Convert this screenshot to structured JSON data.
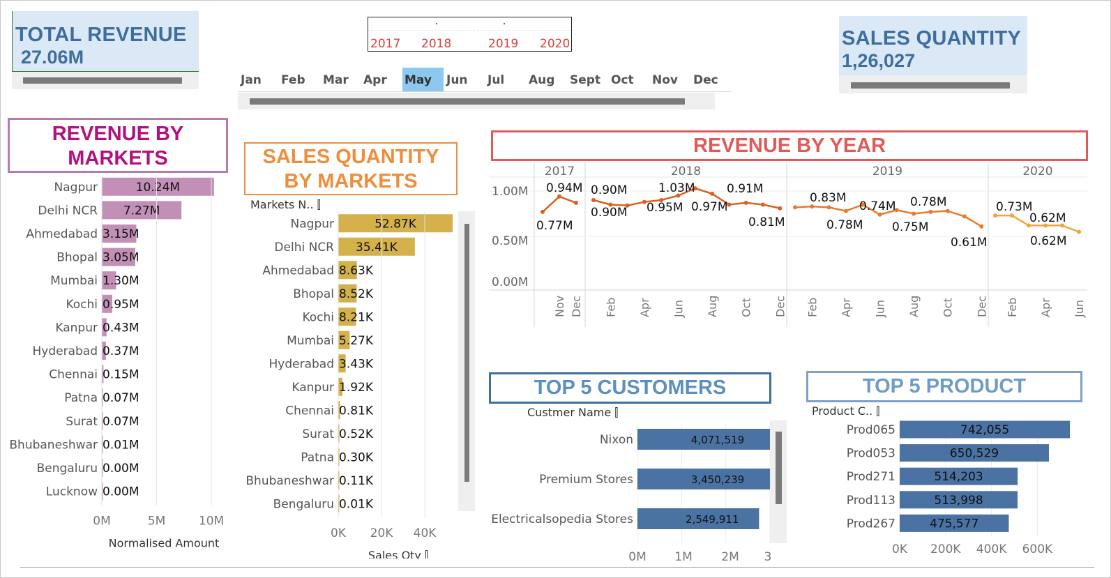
{
  "kpis": {
    "total_revenue": {
      "title": "TOTAL REVENUE",
      "value": "27.06M"
    },
    "sales_quantity": {
      "title": "SALES QUANTITY",
      "value": "1,26,027"
    }
  },
  "filters": {
    "years": [
      "2017",
      "2018",
      "2019",
      "2020"
    ],
    "months": [
      "Jan",
      "Feb",
      "Mar",
      "Apr",
      "May",
      "Jun",
      "Jul",
      "Aug",
      "Sept",
      "Oct",
      "Nov",
      "Dec"
    ],
    "selected_month": "May"
  },
  "titles": {
    "revenue_by_markets": "REVENUE BY MARKETS",
    "sales_qty_by_markets": "SALES QUANTITY BY MARKETS",
    "revenue_by_year": "REVENUE BY YEAR",
    "top5_customers": "TOP 5 CUSTOMERS",
    "top5_product": "TOP 5 PRODUCT"
  },
  "colors": {
    "revenue_bar": "#c28fb6",
    "qty_bar": "#d4b14a",
    "line": "#d9601f",
    "line_2020": "#f2a33a",
    "blue_bar": "#4a72a3",
    "kpi_bg": "#dbe8f5",
    "kpi_text": "#3e6e9e"
  },
  "chart_data": [
    {
      "type": "bar",
      "orientation": "horizontal",
      "categories": [
        "Nagpur",
        "Delhi NCR",
        "Ahmedabad",
        "Bhopal",
        "Mumbai",
        "Kochi",
        "Kanpur",
        "Hyderabad",
        "Chennai",
        "Patna",
        "Surat",
        "Bhubaneshwar",
        "Bengaluru",
        "Lucknow"
      ],
      "values": [
        10.24,
        7.27,
        3.15,
        3.05,
        1.3,
        0.95,
        0.43,
        0.37,
        0.15,
        0.07,
        0.07,
        0.01,
        0.0,
        0.0
      ],
      "labels": [
        "10.24M",
        "7.27M",
        "3.15M",
        "3.05M",
        "1.30M",
        "0.95M",
        "0.43M",
        "0.37M",
        "0.15M",
        "0.07M",
        "0.07M",
        "0.01M",
        "0.00M",
        "0.00M"
      ],
      "xticks": [
        "0M",
        "5M",
        "10M"
      ],
      "xlabel": "Normalised Amount",
      "xlim": [
        0,
        11
      ]
    },
    {
      "type": "bar",
      "orientation": "horizontal",
      "header": "Markets N..",
      "categories": [
        "Nagpur",
        "Delhi NCR",
        "Ahmedabad",
        "Bhopal",
        "Kochi",
        "Mumbai",
        "Hyderabad",
        "Kanpur",
        "Chennai",
        "Surat",
        "Patna",
        "Bhubaneshwar",
        "Bengaluru"
      ],
      "values": [
        52.87,
        35.41,
        8.63,
        8.52,
        8.21,
        5.27,
        3.43,
        1.92,
        0.81,
        0.52,
        0.3,
        0.11,
        0.01
      ],
      "labels": [
        "52.87K",
        "35.41K",
        "8.63K",
        "8.52K",
        "8.21K",
        "5.27K",
        "3.43K",
        "1.92K",
        "0.81K",
        "0.52K",
        "0.30K",
        "0.11K",
        "0.01K"
      ],
      "xticks": [
        "0K",
        "20K",
        "40K"
      ],
      "xlabel": "Sales Qty",
      "xlim": [
        0,
        53
      ]
    },
    {
      "type": "line",
      "years": [
        "2017",
        "2018",
        "2019",
        "2020"
      ],
      "yticks": [
        "1.00M",
        "0.50M",
        "0.00M"
      ],
      "ylim": [
        0,
        1.1
      ],
      "xtick_labels": {
        "2017": [
          "Nov",
          "Dec"
        ],
        "2018": [
          "Feb",
          "Apr",
          "Jun",
          "Aug",
          "Oct",
          "Dec"
        ],
        "2019": [
          "Feb",
          "Apr",
          "Jun",
          "Aug",
          "Oct",
          "Dec"
        ],
        "2020": [
          "Feb",
          "Apr",
          "Jun"
        ]
      },
      "series": [
        {
          "year": "2017",
          "months": [
            10,
            11,
            12
          ],
          "values": [
            0.77,
            0.94,
            0.87
          ]
        },
        {
          "year": "2018",
          "months": [
            1,
            2,
            3,
            4,
            5,
            6,
            7,
            8,
            9,
            10,
            11,
            12
          ],
          "values": [
            0.9,
            0.85,
            0.84,
            0.88,
            0.9,
            0.95,
            1.03,
            0.97,
            0.85,
            0.87,
            0.85,
            0.81
          ]
        },
        {
          "year": "2019",
          "months": [
            1,
            2,
            3,
            4,
            5,
            6,
            7,
            8,
            9,
            10,
            11,
            12
          ],
          "values": [
            0.82,
            0.83,
            0.82,
            0.78,
            0.85,
            0.74,
            0.79,
            0.75,
            0.77,
            0.78,
            0.72,
            0.61
          ]
        },
        {
          "year": "2020",
          "months": [
            1,
            2,
            3,
            4,
            5,
            6
          ],
          "values": [
            0.73,
            0.73,
            0.62,
            0.62,
            0.62,
            0.55
          ]
        }
      ],
      "annotations": [
        "0.77M",
        "0.94M",
        "0.90M",
        "0.90M",
        "0.95M",
        "1.03M",
        "0.97M",
        "0.91M",
        "0.81M",
        "0.83M",
        "0.78M",
        "0.74M",
        "0.75M",
        "0.78M",
        "0.61M",
        "0.73M",
        "0.62M",
        "0.62M"
      ]
    },
    {
      "type": "bar",
      "orientation": "horizontal",
      "header": "Custmer Name",
      "categories": [
        "Nixon",
        "Premium Stores",
        "Electricalsopedia Stores"
      ],
      "values": [
        4071519,
        3450239,
        2549911
      ],
      "labels": [
        "4,071,519",
        "3,450,239",
        "2,549,911"
      ],
      "xticks": [
        "0M",
        "1M",
        "2M",
        "3"
      ],
      "xlim": [
        0,
        3000000
      ]
    },
    {
      "type": "bar",
      "orientation": "horizontal",
      "header": "Product C..",
      "categories": [
        "Prod065",
        "Prod053",
        "Prod271",
        "Prod113",
        "Prod267"
      ],
      "values": [
        742055,
        650529,
        514203,
        513998,
        475577
      ],
      "labels": [
        "742,055",
        "650,529",
        "514,203",
        "513,998",
        "475,577"
      ],
      "xticks": [
        "0K",
        "200K",
        "400K",
        "600K"
      ],
      "xlim": [
        0,
        760000
      ]
    }
  ]
}
